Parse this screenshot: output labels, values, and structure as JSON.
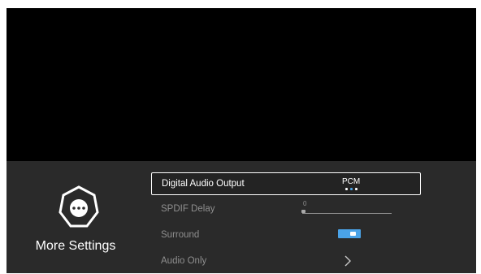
{
  "panel": {
    "title": "More Settings",
    "icon": "more-dots-icon"
  },
  "menu": {
    "items": [
      {
        "label": "Digital Audio Output",
        "value": "PCM",
        "selected": true,
        "options_count": 3,
        "active_option": 2
      },
      {
        "label": "SPDIF Delay",
        "value": "0",
        "level": 0.0
      },
      {
        "label": "Surround",
        "toggle_on": true
      },
      {
        "label": "Audio Only",
        "icon": "chevron-right-icon"
      }
    ]
  },
  "colors": {
    "accent": "#4aa3e8",
    "inactive_text": "#8f8f8f",
    "selected_text": "#ffffff",
    "panel_bg": "#2a2a2a"
  }
}
